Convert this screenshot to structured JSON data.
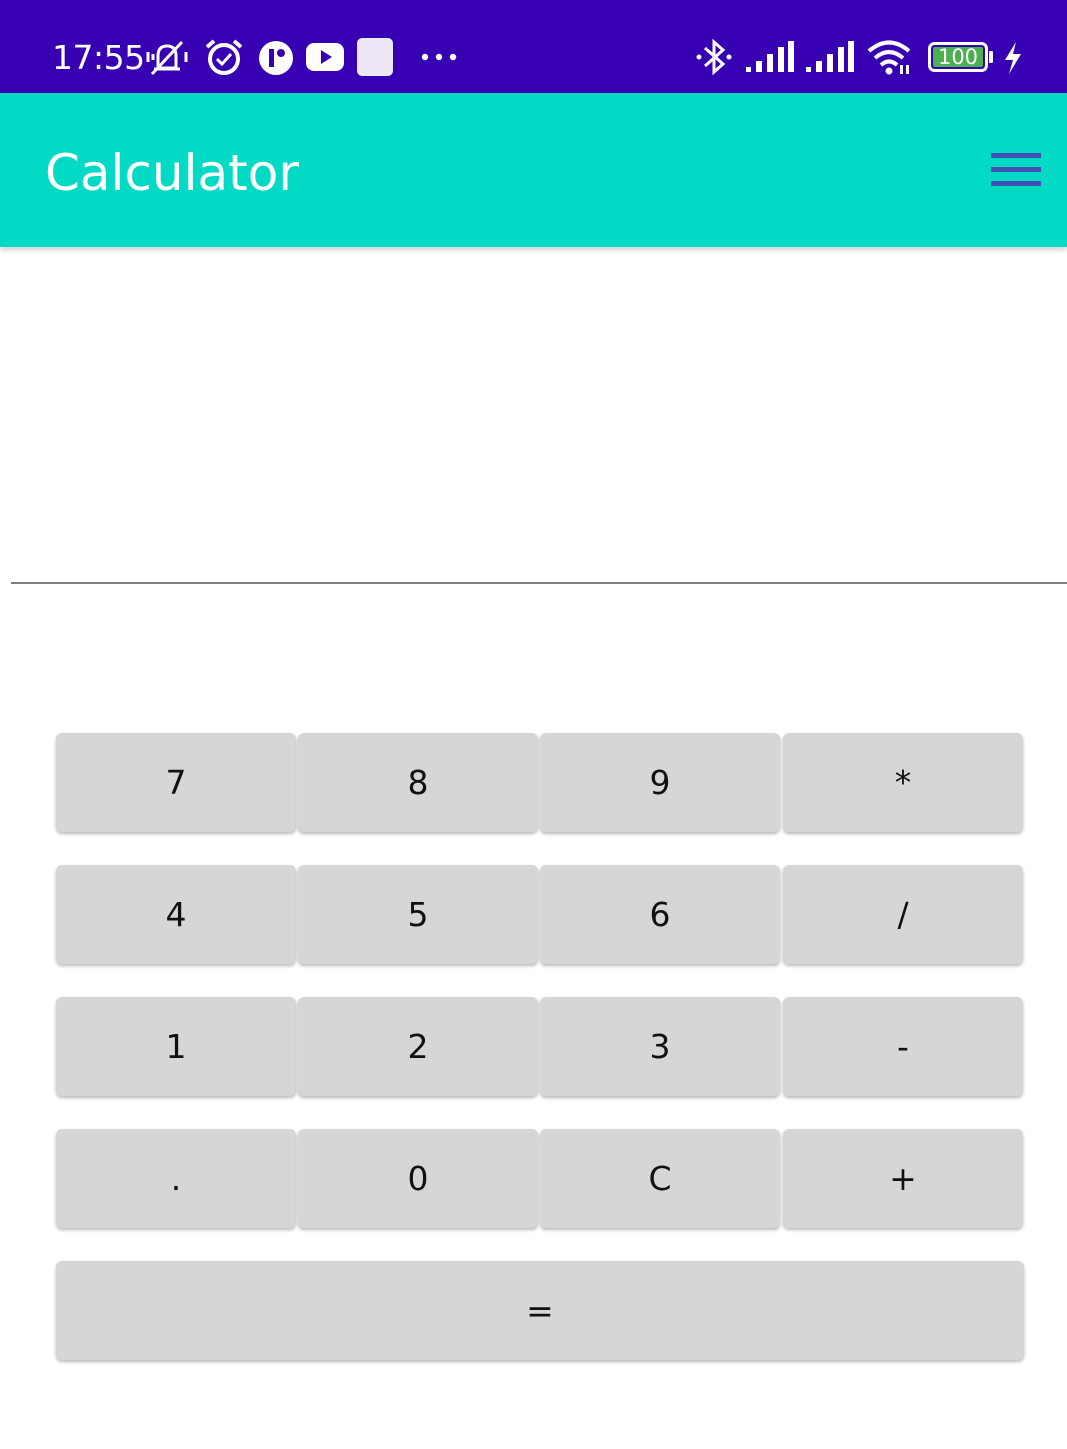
{
  "status_bar": {
    "time": "17:55",
    "battery_level": "100",
    "icons": [
      "mute-vibrate-icon",
      "alarm-icon",
      "app-notification-icon",
      "youtube-icon",
      "square-notification-icon",
      "more-dots-icon",
      "bluetooth-icon",
      "signal-1-icon",
      "signal-2-icon",
      "wifi-icon",
      "battery-icon",
      "charging-icon"
    ],
    "colors": {
      "background": "#3700b3",
      "battery_fill": "#4caf50"
    }
  },
  "app_bar": {
    "title": "Calculator",
    "menu_icon": "hamburger-menu-icon",
    "colors": {
      "background": "#03dac5",
      "menu": "#3f51b5"
    }
  },
  "display": {
    "value": ""
  },
  "keypad": {
    "rows": [
      [
        "7",
        "8",
        "9",
        "*"
      ],
      [
        "4",
        "5",
        "6",
        "/"
      ],
      [
        "1",
        "2",
        "3",
        "-"
      ],
      [
        ".",
        "0",
        "C",
        "+"
      ]
    ],
    "equals": "=",
    "colors": {
      "key_background": "#d6d6d6"
    }
  }
}
